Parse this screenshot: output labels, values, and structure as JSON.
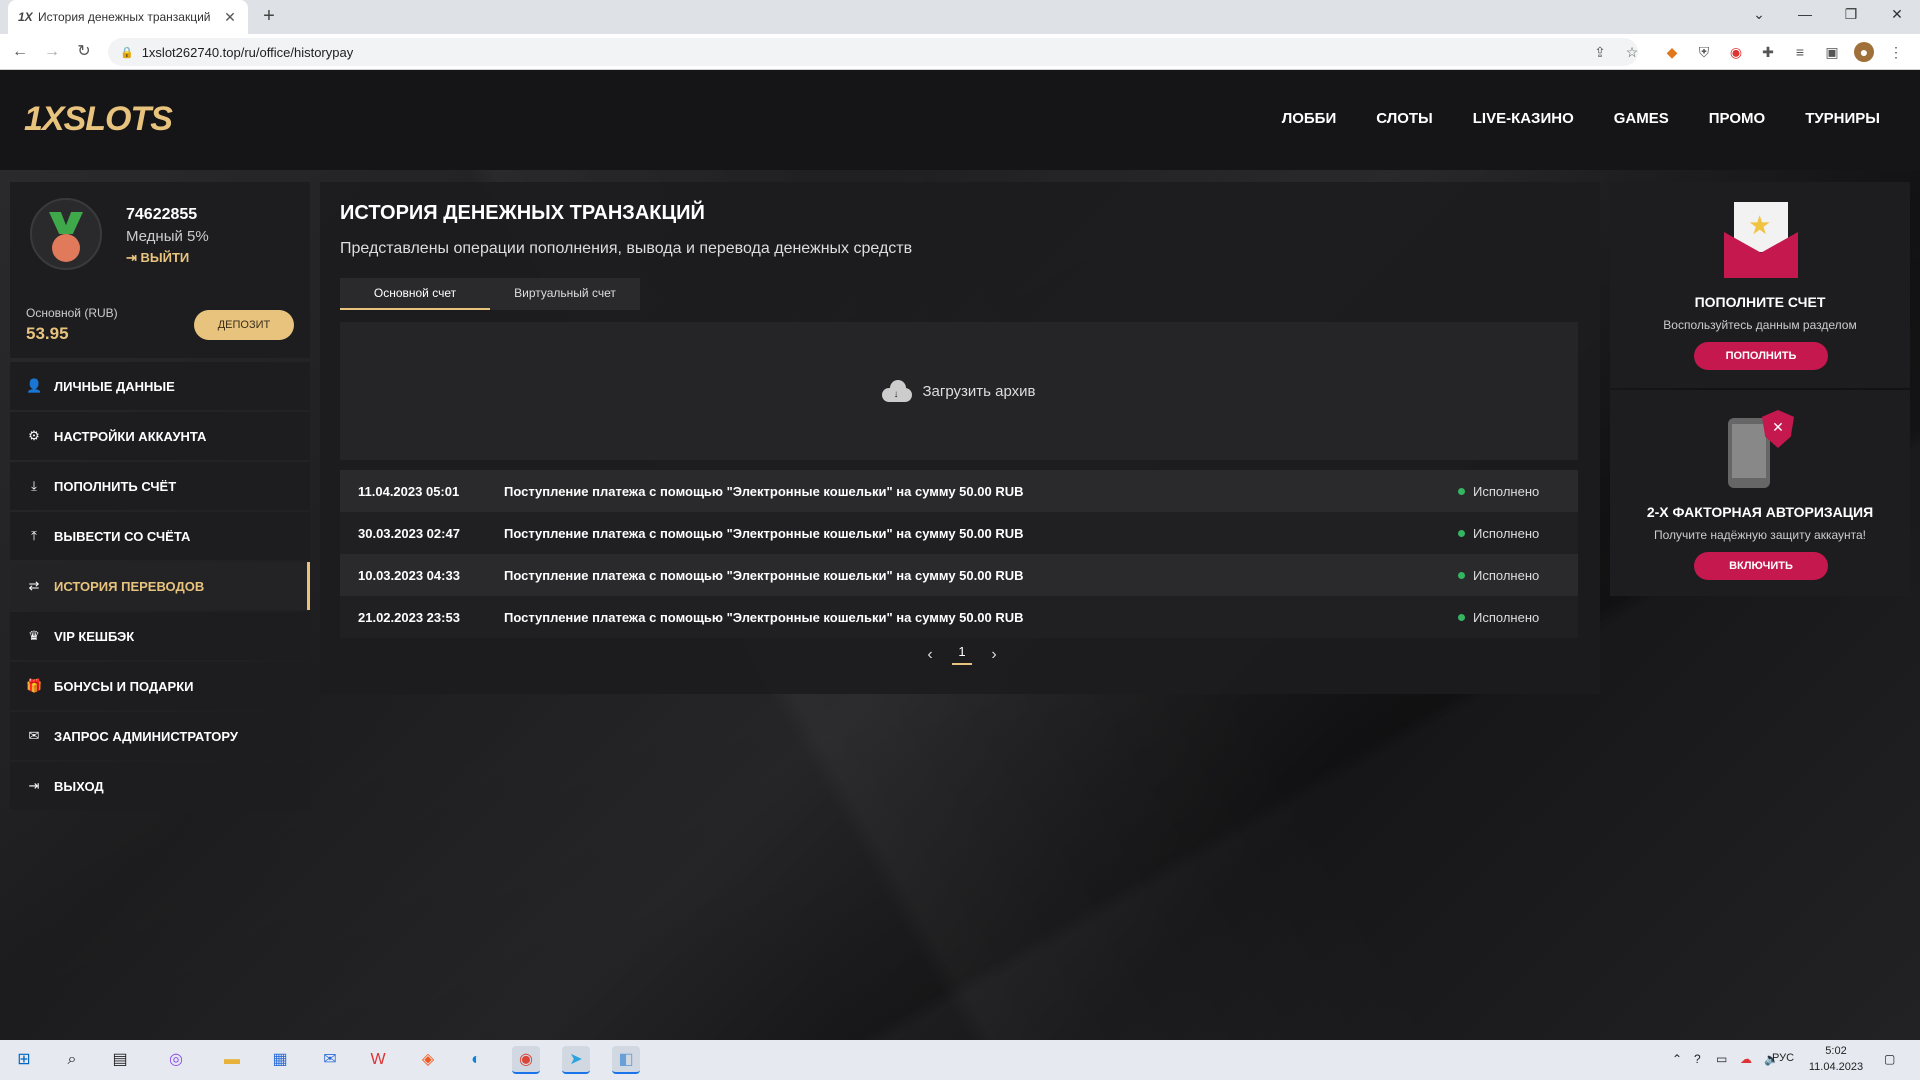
{
  "browser": {
    "tab_title": "История денежных транзакций",
    "tab_favicon": "1X",
    "url": "1xslot262740.top/ru/office/historypay"
  },
  "header": {
    "logo": "1XSLOTS",
    "nav": [
      "ЛОББИ",
      "СЛОТЫ",
      "LIVE-КАЗИНО",
      "GAMES",
      "ПРОМО",
      "ТУРНИРЫ"
    ]
  },
  "profile": {
    "user_id": "74622855",
    "rank": "Медный 5%",
    "logout": "ВЫЙТИ",
    "balance_label": "Основной (RUB)",
    "balance_value": "53.95",
    "deposit_button": "ДЕПОЗИТ"
  },
  "sidebar": {
    "items": [
      {
        "label": "ЛИЧНЫЕ ДАННЫЕ",
        "icon": "user-icon"
      },
      {
        "label": "НАСТРОЙКИ АККАУНТА",
        "icon": "gears-icon"
      },
      {
        "label": "ПОПОЛНИТЬ СЧЁТ",
        "icon": "download-icon"
      },
      {
        "label": "ВЫВЕСТИ СО СЧЁТА",
        "icon": "upload-icon"
      },
      {
        "label": "ИСТОРИЯ ПЕРЕВОДОВ",
        "icon": "transfer-icon"
      },
      {
        "label": "VIP КЕШБЭК",
        "icon": "crown-icon"
      },
      {
        "label": "БОНУСЫ И ПОДАРКИ",
        "icon": "gift-icon"
      },
      {
        "label": "ЗАПРОС АДМИНИСТРАТОРУ",
        "icon": "mail-icon"
      },
      {
        "label": "ВЫХОД",
        "icon": "exit-icon"
      }
    ],
    "active_index": 4
  },
  "main": {
    "title": "ИСТОРИЯ ДЕНЕЖНЫХ ТРАНЗАКЦИЙ",
    "subtitle": "Представлены операции пополнения, вывода и перевода денежных средств",
    "tabs": [
      "Основной счет",
      "Виртуальный счет"
    ],
    "archive_label": "Загрузить архив",
    "transactions": [
      {
        "date": "11.04.2023 05:01",
        "desc": "Поступление платежа с помощью \"Электронные кошельки\" на сумму 50.00 RUB",
        "status": "Исполнено"
      },
      {
        "date": "30.03.2023 02:47",
        "desc": "Поступление платежа с помощью \"Электронные кошельки\" на сумму 50.00 RUB",
        "status": "Исполнено"
      },
      {
        "date": "10.03.2023 04:33",
        "desc": "Поступление платежа с помощью \"Электронные кошельки\" на сумму 50.00 RUB",
        "status": "Исполнено"
      },
      {
        "date": "21.02.2023 23:53",
        "desc": "Поступление платежа с помощью \"Электронные кошельки\" на сумму 50.00 RUB",
        "status": "Исполнено"
      }
    ],
    "page": "1"
  },
  "promo": {
    "deposit": {
      "title": "ПОПОЛНИТЕ СЧЕТ",
      "desc": "Воспользуйтесь данным разделом",
      "button": "ПОПОЛНИТЬ"
    },
    "twofa": {
      "title": "2-Х ФАКТОРНАЯ АВТОРИЗАЦИЯ",
      "desc": "Получите надёжную защиту аккаунта!",
      "button": "ВКЛЮЧИТЬ"
    }
  },
  "taskbar": {
    "lang": "РУС",
    "time": "5:02",
    "date": "11.04.2023"
  },
  "colors": {
    "accent": "#e8c37d",
    "promo_button": "#c4184f",
    "status_ok": "#34b562"
  }
}
